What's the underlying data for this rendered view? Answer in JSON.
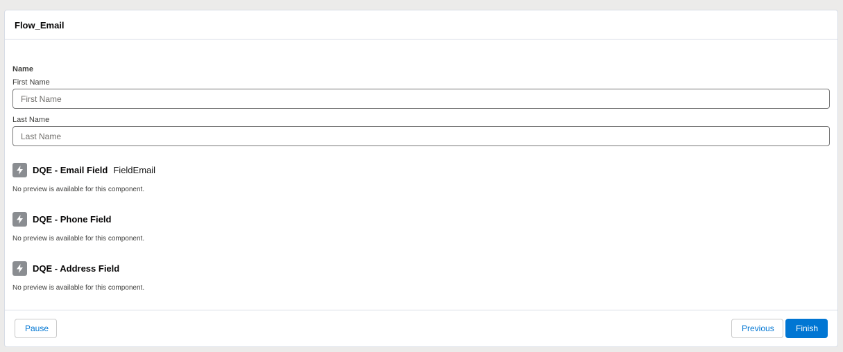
{
  "flow": {
    "title": "Flow_Email"
  },
  "name_section": {
    "label": "Name",
    "first_name_label": "First Name",
    "first_name_placeholder": "First Name",
    "first_name_value": "",
    "last_name_label": "Last Name",
    "last_name_placeholder": "Last Name",
    "last_name_value": ""
  },
  "components": [
    {
      "title": "DQE - Email Field",
      "subtitle": "FieldEmail",
      "note": "No preview is available for this component.",
      "icon": "lightning-bolt-icon"
    },
    {
      "title": "DQE - Phone Field",
      "subtitle": "",
      "note": "No preview is available for this component.",
      "icon": "lightning-bolt-icon"
    },
    {
      "title": "DQE - Address Field",
      "subtitle": "",
      "note": "No preview is available for this component.",
      "icon": "lightning-bolt-icon"
    }
  ],
  "footer": {
    "pause_label": "Pause",
    "previous_label": "Previous",
    "finish_label": "Finish"
  },
  "colors": {
    "brand": "#0176d3",
    "icon_bg": "#8a8d91",
    "page_bg": "#ecebea"
  }
}
